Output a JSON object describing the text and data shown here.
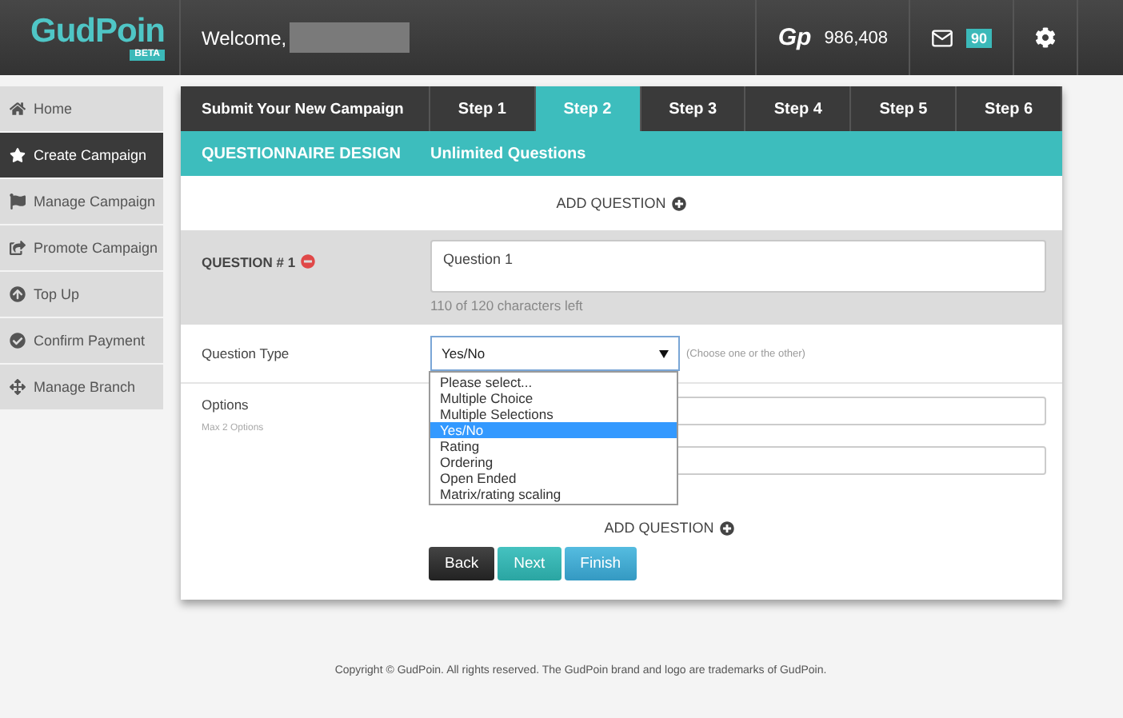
{
  "header": {
    "logo": "GudPoin",
    "logo_badge": "BETA",
    "welcome": "Welcome,",
    "brand_mark": "Gp",
    "points": "986,408",
    "messages_count": "90"
  },
  "sidebar": {
    "items": [
      {
        "label": "Home",
        "kind": "home",
        "selected": false
      },
      {
        "label": "Create Campaign",
        "kind": "star",
        "selected": true
      },
      {
        "label": "Manage Campaign",
        "kind": "flag",
        "selected": false
      },
      {
        "label": "Promote Campaign",
        "kind": "share",
        "selected": false
      },
      {
        "label": "Top Up",
        "kind": "up",
        "selected": false
      },
      {
        "label": "Confirm Payment",
        "kind": "check",
        "selected": false
      },
      {
        "label": "Manage Branch",
        "kind": "move",
        "selected": false
      }
    ]
  },
  "wizard": {
    "title": "Submit Your New Campaign",
    "steps": [
      {
        "label": "Step 1",
        "selected": false
      },
      {
        "label": "Step 2",
        "selected": true
      },
      {
        "label": "Step 3",
        "selected": false
      },
      {
        "label": "Step 4",
        "selected": false
      },
      {
        "label": "Step 5",
        "selected": false
      },
      {
        "label": "Step 6",
        "selected": false
      }
    ],
    "section": "QUESTIONNAIRE DESIGN",
    "section_note": "Unlimited Questions"
  },
  "form": {
    "add_question_top": "ADD QUESTION",
    "question_label": "QUESTION # 1",
    "question_value": "Question 1",
    "char_count": "110 of 120 characters left",
    "type_label": "Question Type",
    "type_value": "Yes/No",
    "type_hint": "(Choose one or the other)",
    "type_options": [
      {
        "label": "Please select...",
        "selected": false
      },
      {
        "label": "Multiple Choice",
        "selected": false
      },
      {
        "label": "Multiple Selections",
        "selected": false
      },
      {
        "label": "Yes/No",
        "selected": true
      },
      {
        "label": "Rating",
        "selected": false
      },
      {
        "label": "Ordering",
        "selected": false
      },
      {
        "label": "Open Ended",
        "selected": false
      },
      {
        "label": "Matrix/rating scaling",
        "selected": false
      }
    ],
    "options_label": "Options",
    "options_hint": "Max 2 Options",
    "add_question_bottom": "ADD QUESTION",
    "buttons": [
      {
        "label": "Back",
        "kind": "dark"
      },
      {
        "label": "Next",
        "kind": "teal"
      },
      {
        "label": "Finish",
        "kind": "blue"
      }
    ]
  },
  "footer": "Copyright © GudPoin. All rights reserved. The GudPoin brand and logo are trademarks of GudPoin."
}
